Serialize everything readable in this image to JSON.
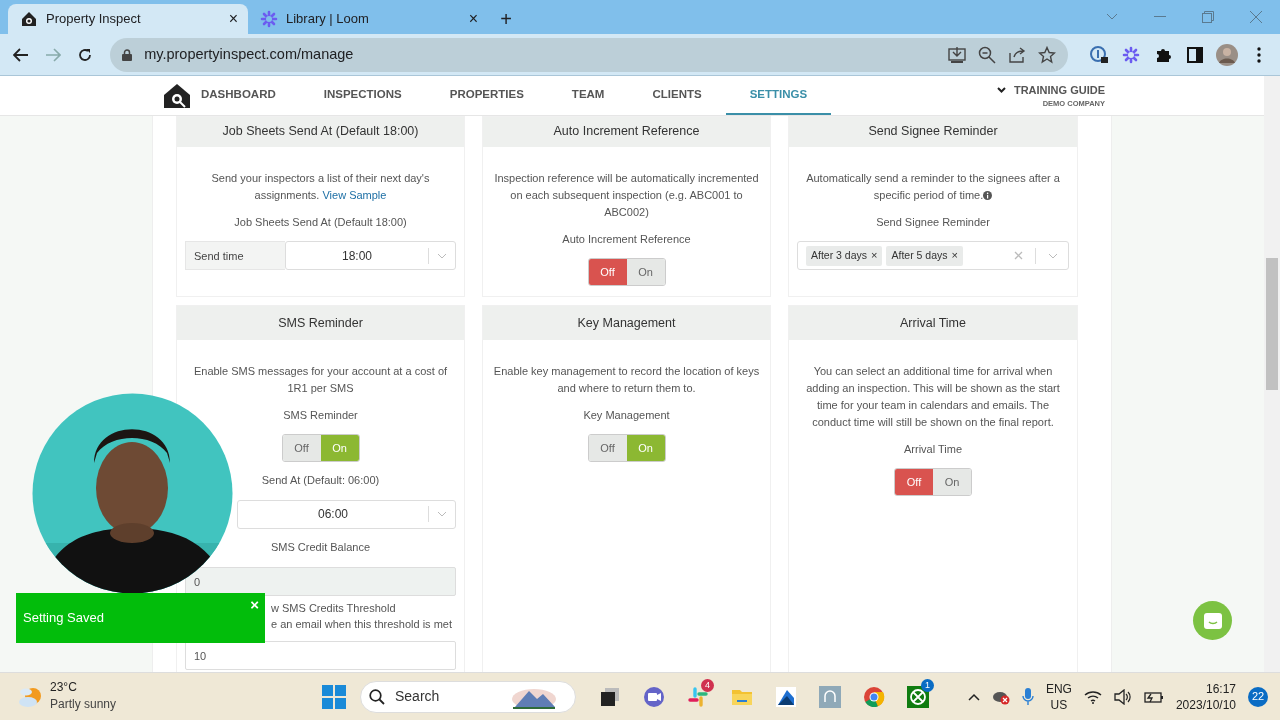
{
  "browser": {
    "tabs": [
      {
        "title": "Property Inspect",
        "selected": true,
        "close": "×"
      },
      {
        "title": "Library | Loom",
        "selected": false,
        "close": "×"
      }
    ],
    "new_tab": "+",
    "address": "my.propertyinspect.com/manage"
  },
  "nav": {
    "items": [
      {
        "label": "DASHBOARD",
        "selected": false
      },
      {
        "label": "INSPECTIONS",
        "selected": false
      },
      {
        "label": "PROPERTIES",
        "selected": false
      },
      {
        "label": "TEAM",
        "selected": false
      },
      {
        "label": "CLIENTS",
        "selected": false
      },
      {
        "label": "SETTINGS",
        "selected": true
      }
    ],
    "account": {
      "name": "TRAINING GUIDE",
      "company": "DEMO COMPANY"
    }
  },
  "settings": {
    "cards": [
      {
        "title": "Job Sheets Send At (Default 18:00)",
        "fields": [
          {
            "kind": "description",
            "text": "Send your inspectors a list of their next day's assignments.",
            "link": "View Sample"
          },
          {
            "kind": "label",
            "text": "Job Sheets Send At (Default 18:00)"
          },
          {
            "kind": "select",
            "addon": "Send time",
            "value": "18:00"
          }
        ]
      },
      {
        "title": "Auto Increment Reference",
        "fields": [
          {
            "kind": "description",
            "text": "Inspection reference will be automatically incremented on each subsequent inspection (e.g. ABC001 to ABC002)"
          },
          {
            "kind": "label",
            "text": "Auto Increment Reference"
          },
          {
            "kind": "toggle",
            "on": false,
            "off_label": "Off",
            "on_label": "On"
          }
        ]
      },
      {
        "title": "Send Signee Reminder",
        "fields": [
          {
            "kind": "description",
            "text": "Automatically send a reminder to the signees after a specific period of time.",
            "info": true
          },
          {
            "kind": "label",
            "text": "Send Signee Reminder"
          },
          {
            "kind": "tags",
            "tags": [
              {
                "label": "After 3 days",
                "remove": "×"
              },
              {
                "label": "After 5 days",
                "remove": "×"
              }
            ]
          }
        ]
      },
      {
        "title": "SMS Reminder",
        "fields": [
          {
            "kind": "description",
            "text": "Enable SMS messages for your account at a cost of 1R1 per SMS"
          },
          {
            "kind": "label",
            "text": "SMS Reminder"
          },
          {
            "kind": "toggle",
            "on": true,
            "off_label": "Off",
            "on_label": "On"
          },
          {
            "kind": "label",
            "text": "Send At (Default: 06:00)"
          },
          {
            "kind": "select",
            "value": "06:00"
          },
          {
            "kind": "label",
            "text": "SMS Credit Balance"
          },
          {
            "kind": "input",
            "value": "0",
            "disabled": true
          },
          {
            "kind": "note",
            "text": "w SMS Credits Threshold"
          },
          {
            "kind": "note",
            "text": "e an email when this threshold is met"
          },
          {
            "kind": "input",
            "value": "10",
            "disabled": false
          }
        ]
      },
      {
        "title": "Key Management",
        "fields": [
          {
            "kind": "description",
            "text": "Enable key management to record the location of keys and where to return them to."
          },
          {
            "kind": "label",
            "text": "Key Management"
          },
          {
            "kind": "toggle",
            "on": true,
            "off_label": "Off",
            "on_label": "On"
          }
        ]
      },
      {
        "title": "Arrival Time",
        "fields": [
          {
            "kind": "description",
            "text": "You can select an additional time for arrival when adding an inspection. This will be shown as the start time for your team in calendars and emails. The conduct time will still be shown on the final report."
          },
          {
            "kind": "label",
            "text": "Arrival Time"
          },
          {
            "kind": "toggle",
            "on": false,
            "off_label": "Off",
            "on_label": "On"
          }
        ]
      }
    ]
  },
  "overlay": {
    "toast": {
      "text": "Setting Saved",
      "close": "×"
    }
  },
  "taskbar": {
    "weather": {
      "temp": "23°C",
      "desc": "Partly sunny"
    },
    "search": {
      "placeholder": "Search"
    },
    "apps": [
      {
        "kind": "taskview"
      },
      {
        "kind": "meet"
      },
      {
        "kind": "slack",
        "badge": "4"
      },
      {
        "kind": "folder"
      },
      {
        "kind": "store"
      },
      {
        "kind": "copilot"
      },
      {
        "kind": "chrome"
      },
      {
        "kind": "xbox",
        "badge": "1"
      }
    ],
    "lang": [
      "ENG",
      "US"
    ],
    "time": "16:17",
    "date": "2023/10/10",
    "notifications": "22"
  }
}
